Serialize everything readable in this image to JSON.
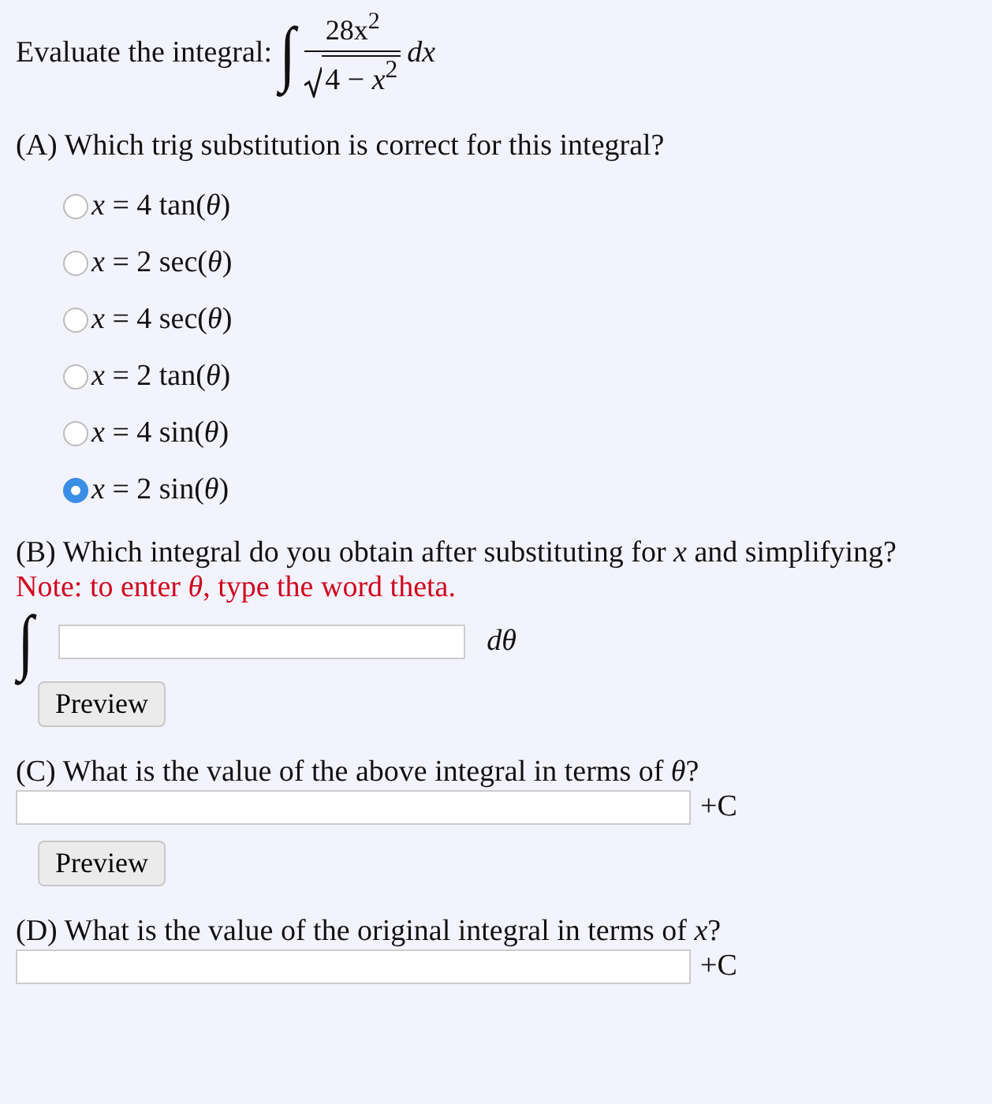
{
  "prompt": {
    "label": "Evaluate the integral:",
    "integral_sign": "∫",
    "numerator": "28x$^{2}$",
    "denominator": "4 − *x*$^{2}$",
    "differential": "*dx*"
  },
  "part_a": {
    "question": "(A) Which trig substitution is correct for this integral?",
    "options": [
      {
        "label": "*x* = 4 tan(*θ*)",
        "selected": false
      },
      {
        "label": "*x* = 2 sec(*θ*)",
        "selected": false
      },
      {
        "label": "*x* = 4 sec(*θ*)",
        "selected": false
      },
      {
        "label": "*x* = 2 tan(*θ*)",
        "selected": false
      },
      {
        "label": "*x* = 4 sin(*θ*)",
        "selected": false
      },
      {
        "label": "*x* = 2 sin(*θ*)",
        "selected": true
      }
    ]
  },
  "part_b": {
    "question": "(B) Which integral do you obtain after substituting for *x* and simplifying?",
    "note": "Note: to enter *θ*, type the word theta.",
    "integral_sign": "∫",
    "differential": "*dθ*",
    "button": "Preview"
  },
  "part_c": {
    "question": "(C) What is the value of the above integral in terms of *θ*?",
    "suffix": "+C",
    "button": "Preview"
  },
  "part_d": {
    "question": "(D) What is the value of the original integral in terms of *x*?",
    "suffix": "+C"
  }
}
